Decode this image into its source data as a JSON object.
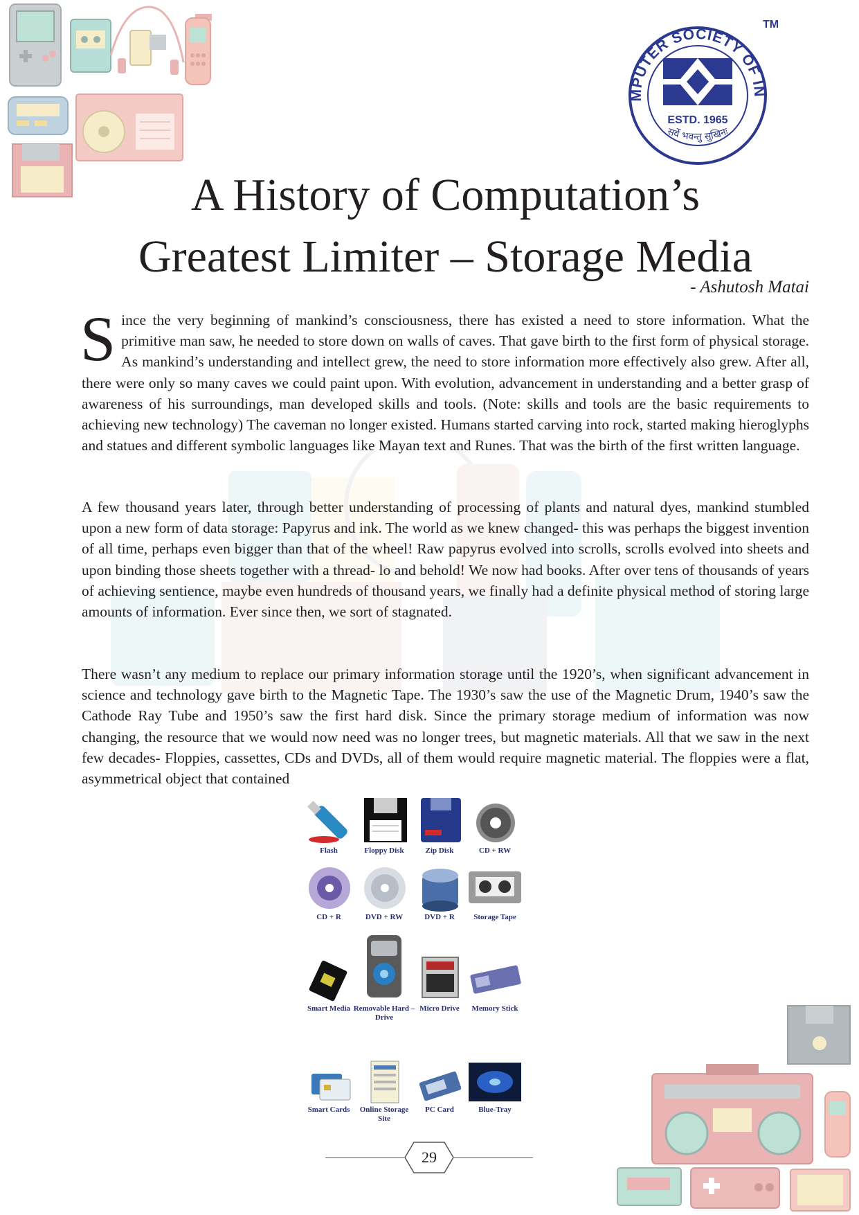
{
  "logo": {
    "text_top": "COMPUTER SOCIETY OF INDIA",
    "tm": "TM",
    "estd": "ESTD. 1965",
    "motto": "सर्वे भवन्तु सुखिनः"
  },
  "article": {
    "title_line1": "A History of Computation’s",
    "title_line2": "Greatest Limiter – Storage Media",
    "byline": "- Ashutosh Matai",
    "drop_cap": "S",
    "paragraphs": [
      "ince the very beginning of mankind’s consciousness, there has existed a need to store information. What the primitive man saw, he needed to store down on walls of caves. That gave birth to the first form of physical storage. As mankind’s understanding and intellect grew, the need to store information more effectively also grew. After all, there were only so many caves we could paint upon. With evolution, advancement in understanding and a better grasp of awareness of his surroundings, man developed skills and tools. (Note: skills and tools are the basic requirements to achieving new technology) The caveman no longer existed. Humans started carving into rock, started making hieroglyphs and statues and different symbolic languages like Mayan text and Runes. That was the birth of the first written language.",
      "A few thousand years later, through better understanding of processing of plants and natural dyes, mankind stumbled upon a new form of data storage: Papyrus and ink. The world as we knew changed- this was perhaps the biggest invention of all time, perhaps even bigger than that of the wheel! Raw papyrus evolved into scrolls, scrolls evolved into sheets and upon binding those sheets together with a thread- lo and behold! We now had books. After over tens of thousands of years of achieving sentience, maybe even hundreds of thousand years, we finally had a definite physical method of storing large amounts of information. Ever since then, we sort of stagnated.",
      "There wasn’t any medium to replace our primary information storage until the 1920’s, when significant advancement in science and technology gave birth to the Magnetic Tape. The 1930’s saw the use of the Magnetic Drum, 1940’s saw the Cathode Ray Tube and 1950’s saw the first hard disk. Since the primary storage medium of information was now changing, the resource that we would now need was no longer trees, but magnetic materials. All that we saw in the next few decades- Floppies, cassettes, CDs and DVDs, all of them would require magnetic material. The floppies were a flat, asymmetrical object that contained"
    ]
  },
  "media_figure": {
    "items": [
      {
        "label": "Flash",
        "icon": "usb-flash-drive-icon"
      },
      {
        "label": "Floppy Disk",
        "icon": "floppy-disk-icon"
      },
      {
        "label": "Zip Disk",
        "icon": "zip-disk-icon"
      },
      {
        "label": "CD + RW",
        "icon": "cd-rw-icon"
      },
      {
        "label": "CD + R",
        "icon": "cd-r-icon"
      },
      {
        "label": "DVD + RW",
        "icon": "dvd-rw-icon"
      },
      {
        "label": "DVD + R",
        "icon": "dvd-spindle-icon"
      },
      {
        "label": "Storage Tape",
        "icon": "storage-tape-icon"
      },
      {
        "label": "Smart Media",
        "icon": "smart-media-icon"
      },
      {
        "label": "Removable Hard – Drive",
        "icon": "removable-hard-drive-icon"
      },
      {
        "label": "Micro Drive",
        "icon": "micro-drive-icon"
      },
      {
        "label": "Memory Stick",
        "icon": "memory-stick-icon"
      },
      {
        "label": "Smart Cards",
        "icon": "smart-card-icon"
      },
      {
        "label": "Online Storage Site",
        "icon": "online-storage-icon"
      },
      {
        "label": "PC Card",
        "icon": "pc-card-icon"
      },
      {
        "label": "Blue-Tray",
        "icon": "blu-ray-icon"
      }
    ]
  },
  "page_number": "29",
  "colors": {
    "logo_blue": "#2b3990",
    "text": "#231f20",
    "decor_pink": "#e8a3a3",
    "decor_teal": "#7fc6c4",
    "decor_yellow": "#f3e3a0",
    "decor_grey": "#9aa3a8"
  }
}
